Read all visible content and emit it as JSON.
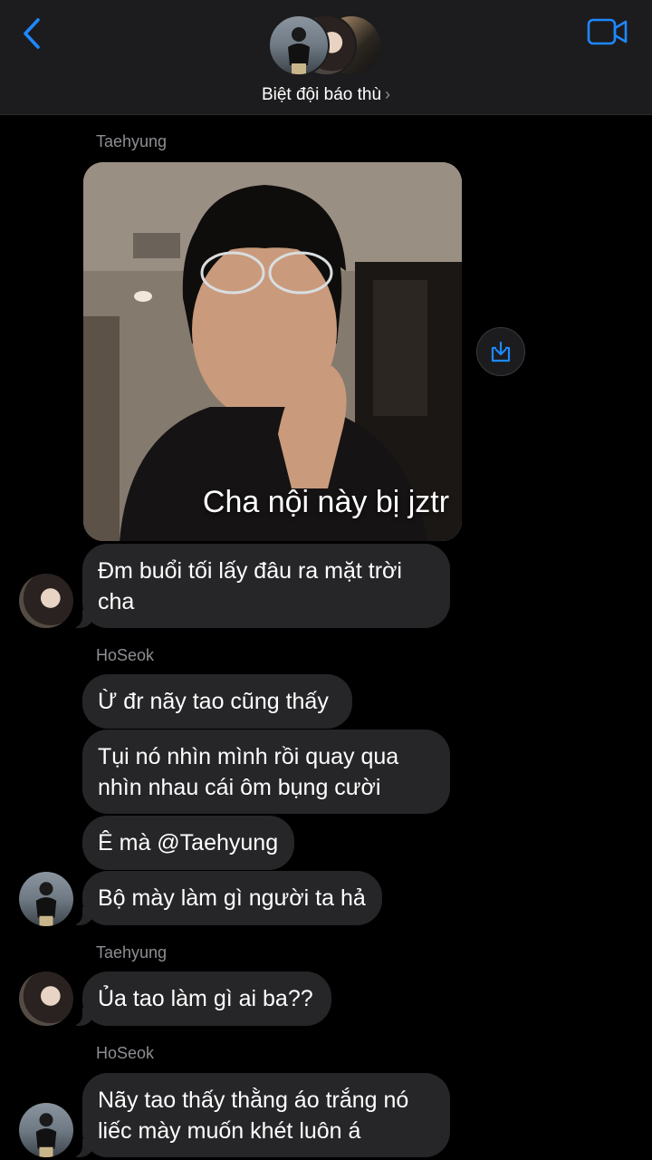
{
  "header": {
    "group_name": "Biệt đội báo thù",
    "chevron": "›",
    "back_icon": "chevron-left-icon",
    "video_icon": "video-camera-icon",
    "accent_color": "#1e88ff"
  },
  "messages": [
    {
      "sender": "Taehyung"
    },
    {
      "media_caption": "Cha nội này bị jztr"
    },
    {
      "text": "Đm buổi tối lấy đâu ra mặt trời cha"
    },
    {
      "sender": "HoSeok"
    },
    {
      "text": "Ừ đr nãy tao cũng thấy"
    },
    {
      "text": "Tụi nó nhìn mình rồi quay qua nhìn nhau cái ôm bụng cười"
    },
    {
      "text": "Ê mà @Taehyung"
    },
    {
      "text": "Bộ mày làm gì người ta hả"
    },
    {
      "sender": "Taehyung"
    },
    {
      "text": "Ủa tao làm gì ai ba??"
    },
    {
      "sender": "HoSeok"
    },
    {
      "text": "Nãy tao thấy thằng áo trắng nó liếc mày muốn khét luôn á"
    }
  ]
}
